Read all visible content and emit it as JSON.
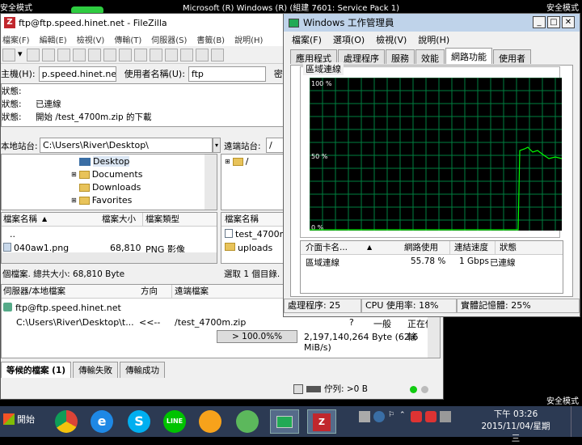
{
  "desktop": {
    "top_title": "Microsoft (R) Windows (R) (組建 7601: Service Pack 1)",
    "safe_mode_left": "安全模式",
    "safe_mode_right": "安全模式",
    "safe_mode_bottom": "安全模式"
  },
  "filezilla": {
    "title": "ftp@ftp.speed.hinet.net - FileZilla",
    "menu": [
      "檔案(F)",
      "編輯(E)",
      "檢視(V)",
      "傳輸(T)",
      "伺服器(S)",
      "書籤(B)",
      "說明(H)"
    ],
    "quickconnect": {
      "host_label": "主機(H):",
      "host_value": "p.speed.hinet.net",
      "user_label": "使用者名稱(U):",
      "user_value": "ftp",
      "pass_label": "密碼"
    },
    "log": [
      {
        "key": "狀態:",
        "text": ""
      },
      {
        "key": "狀態:",
        "text": "已連線"
      },
      {
        "key": "狀態:",
        "text": "開始 /test_4700m.zip 的下載"
      }
    ],
    "local": {
      "site_label": "本地站台:",
      "path": "C:\\Users\\River\\Desktop\\",
      "tree": [
        "Desktop",
        "Documents",
        "Downloads",
        "Favorites"
      ],
      "headers": [
        "檔案名稱",
        "檔案大小",
        "檔案類型"
      ],
      "files": [
        {
          "name": "..",
          "size": "",
          "type": ""
        },
        {
          "name": "040aw1.png",
          "size": "68,810",
          "type": "PNG 影像"
        }
      ],
      "status": "個檔案. 總共大小: 68,810 Byte"
    },
    "remote": {
      "site_label": "遠端站台:",
      "path": "/",
      "tree": [
        "/"
      ],
      "headers": [
        "檔案名稱"
      ],
      "files": [
        "test_4700m",
        "uploads"
      ],
      "status": "選取 1 個目錄."
    },
    "queue": {
      "headers": [
        "伺服器/本地檔案",
        "方向",
        "遠端檔案"
      ],
      "server": "ftp@ftp.speed.hinet.net",
      "local_file": "C:\\Users\\River\\Desktop\\t...",
      "direction": "<<--",
      "remote_file": "/test_4700m.zip",
      "progress": 1.0,
      "progress_label": "> 100.0%%",
      "bytes": "2,197,140,264 Byte (62.6 MiB/s)",
      "col_extra": "?",
      "priority": "一般",
      "state": "正在傳輸"
    },
    "tabs": [
      "等候的檔案 (1)",
      "傳輸失敗",
      "傳輸成功"
    ],
    "footer_queue": "佇列: >0 B"
  },
  "taskmanager": {
    "title": "Windows 工作管理員",
    "menu": [
      "檔案(F)",
      "選項(O)",
      "檢視(V)",
      "說明(H)"
    ],
    "tabs": [
      "應用程式",
      "處理程序",
      "服務",
      "效能",
      "網路功能",
      "使用者"
    ],
    "active_tab": 4,
    "group_label": "區域連線",
    "graph_labels": [
      "100 %",
      "50 %",
      "0 %"
    ],
    "list_headers": [
      "介面卡名...",
      "網路使用",
      "連結速度",
      "狀態"
    ],
    "adapter": {
      "name": "區域連線",
      "usage": "55.78 %",
      "speed": "1 Gbps",
      "state": "已連線"
    },
    "status": {
      "processes": "處理程序: 25",
      "cpu": "CPU 使用率: 18%",
      "memory": "實體記憶體: 25%"
    },
    "colors": {
      "grid": "#008040",
      "line": "#00ff00",
      "bg": "#000000"
    }
  },
  "taskbar": {
    "start_label": "開始",
    "clock_time": "下午 03:26",
    "clock_date": "2015/11/04/星期三"
  }
}
